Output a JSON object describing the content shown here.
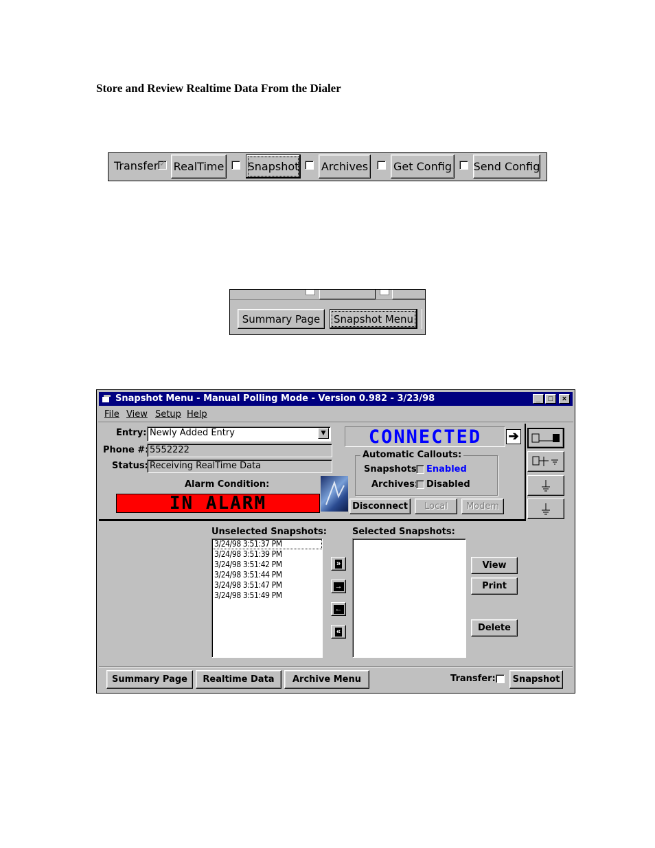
{
  "heading": "Store and Review Realtime Data From the Dialer",
  "toolbar1": {
    "transfer_label": "Transfer:",
    "buttons": [
      "RealTime",
      "Snapshot",
      "Archives",
      "Get Config",
      "Send Config"
    ]
  },
  "toolbar2": {
    "buttons": [
      "Summary Page",
      "Snapshot Menu"
    ]
  },
  "window": {
    "title": "Snapshot Menu - Manual Polling Mode - Version 0.982 - 3/23/98",
    "controls": {
      "minimize": "_",
      "maximize": "□",
      "close": "×"
    },
    "menu": [
      "File",
      "View",
      "Setup",
      "Help"
    ],
    "entry_label": "Entry:",
    "entry_value": "Newly Added Entry",
    "phone_label": "Phone #:",
    "phone_value": "5552222",
    "status_label": "Status:",
    "status_value": "Receiving RealTime Data",
    "alarm_label": "Alarm Condition:",
    "alarm_display": "IN ALARM",
    "connection_display": "CONNECTED",
    "callouts_title": "Automatic Callouts:",
    "snapshots_label": "Snapshots:",
    "snapshots_state": "Enabled",
    "archives_label": "Archives:",
    "archives_state": "Disabled",
    "disconnect": "Disconnect",
    "local": "Local",
    "modem": "Modem",
    "unselected_label": "Unselected Snapshots:",
    "selected_label": "Selected Snapshots:",
    "unselected": [
      "3/24/98 3:51:37 PM",
      "3/24/98 3:51:39 PM",
      "3/24/98 3:51:42 PM",
      "3/24/98 3:51:44 PM",
      "3/24/98 3:51:47 PM",
      "3/24/98 3:51:49 PM"
    ],
    "view": "View",
    "print": "Print",
    "delete": "Delete",
    "bottom_buttons": [
      "Summary Page",
      "Realtime Data",
      "Archive Menu"
    ],
    "transfer_label": "Transfer:",
    "snapshot": "Snapshot"
  },
  "colors": {
    "title_bar": "#000080",
    "alarm_bg": "#ff0000",
    "lcd_text": "#0000ff",
    "face": "#c0c0c0"
  }
}
